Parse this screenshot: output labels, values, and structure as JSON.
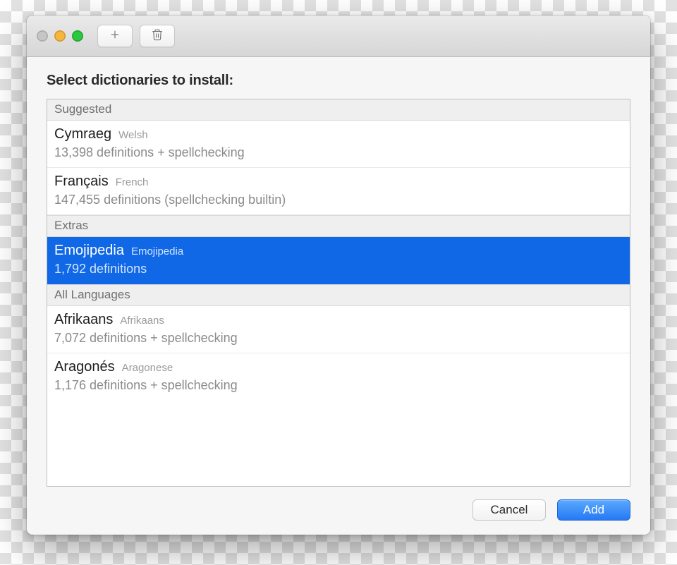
{
  "prompt": "Select dictionaries to install:",
  "sections": {
    "suggested": {
      "header": "Suggested"
    },
    "extras": {
      "header": "Extras"
    },
    "all": {
      "header": "All Languages"
    }
  },
  "rows": {
    "cymraeg": {
      "name": "Cymraeg",
      "sub": "Welsh",
      "detail": "13,398 definitions + spellchecking"
    },
    "francais": {
      "name": "Français",
      "sub": "French",
      "detail": "147,455 definitions (spellchecking builtin)"
    },
    "emojipedia": {
      "name": "Emojipedia",
      "sub": "Emojipedia",
      "detail": "1,792 definitions"
    },
    "afrikaans": {
      "name": "Afrikaans",
      "sub": "Afrikaans",
      "detail": "7,072 definitions + spellchecking"
    },
    "aragones": {
      "name": "Aragonés",
      "sub": "Aragonese",
      "detail": "1,176 definitions + spellchecking"
    }
  },
  "buttons": {
    "cancel": "Cancel",
    "add": "Add"
  }
}
